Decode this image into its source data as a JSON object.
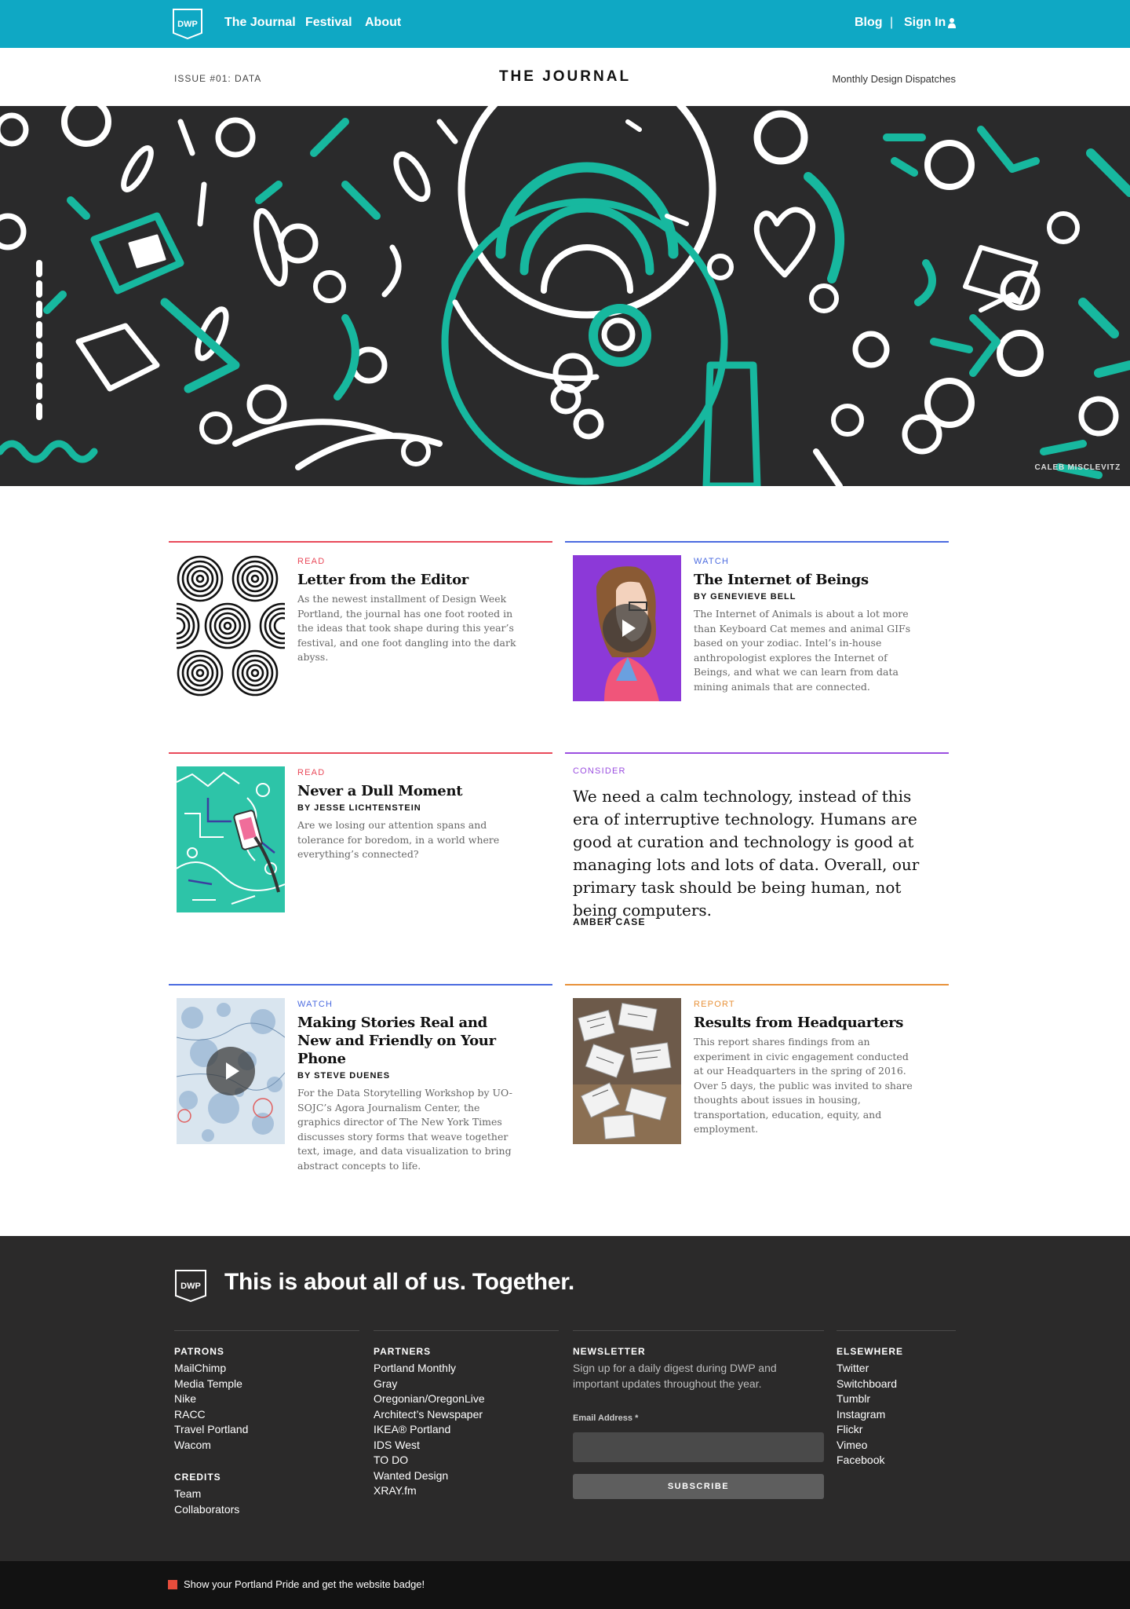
{
  "nav": {
    "logo_text": "DWP",
    "links": [
      "The Journal",
      "Festival",
      "About"
    ],
    "blog": "Blog",
    "separator": "|",
    "sign_in": "Sign In"
  },
  "masthead": {
    "issue": "ISSUE #01: DATA",
    "title": "THE JOURNAL",
    "tagline": "Monthly Design Dispatches"
  },
  "hero": {
    "credit": "CALEB MISCLEVITZ",
    "colors": {
      "background": "#2a2a2b",
      "teal": "#17b89f",
      "white": "#ffffff"
    }
  },
  "cards": [
    {
      "kind": "READ",
      "color": "#e94a5a",
      "title": "Letter from the Editor",
      "byline": "",
      "body": "As the newest installment of Design Week Portland, the journal has one foot rooted in the ideas that took shape during this year’s festival, and one foot dangling into the dark abyss.",
      "thumb": "spiral-pattern",
      "video": false
    },
    {
      "kind": "WATCH",
      "color": "#4b6be0",
      "title": "The Internet of Beings",
      "byline": "BY GENEVIEVE BELL",
      "body": "The Internet of Animals is about a lot more than Keyboard Cat memes and animal GIFs based on your zodiac. Intel’s in-house anthropologist explores the Internet of Beings, and what we can learn from data mining animals that are connected.",
      "thumb": "portrait-illustration",
      "video": true
    },
    {
      "kind": "READ",
      "color": "#e94a5a",
      "title": "Never a Dull Moment",
      "byline": "BY JESSE LICHTENSTEIN",
      "body": "Are we losing our attention spans and tolerance for boredom, in a world where everything’s connected?",
      "thumb": "teal-map-illustration",
      "video": false
    },
    {
      "kind": "WATCH",
      "color": "#4b6be0",
      "title": "Making Stories Real and New and Friendly on Your Phone",
      "byline": "BY STEVE DUENES",
      "body": "For the Data Storytelling Workshop by UO-SOJC’s Agora Journalism Center, the graphics director of The New York Times discusses story forms that weave together text, image, and data visualization to bring abstract concepts to life.",
      "thumb": "blue-dots-map",
      "video": true
    },
    {
      "kind": "REPORT",
      "color": "#e8923a",
      "title": "Results from Headquarters",
      "byline": "",
      "body": "This report shares findings from an experiment in civic engagement conducted at our Headquarters in the spring of 2016. Over 5 days, the public was invited to share thoughts about issues in housing, transportation, education, equity, and employment.",
      "thumb": "cards-photo",
      "video": false
    }
  ],
  "quote": {
    "kind": "CONSIDER",
    "color": "#9b4fe0",
    "text": "We need a calm technology, instead of this era of interruptive technology. Humans are good at curation and technology is good at managing lots and lots of data. Overall, our primary task should be being human, not being computers.",
    "author": "AMBER CASE"
  },
  "footer": {
    "logo_text": "DWP",
    "slogan": "This is about all of us. Together.",
    "patrons": {
      "heading": "PATRONS",
      "items": [
        "MailChimp",
        "Media Temple",
        "Nike",
        "RACC",
        "Travel Portland",
        "Wacom"
      ]
    },
    "credits": {
      "heading": "CREDITS",
      "items": [
        "Team",
        "Collaborators"
      ]
    },
    "partners": {
      "heading": "PARTNERS",
      "items": [
        "Portland Monthly",
        "Gray",
        "Oregonian/OregonLive",
        "Architect’s Newspaper",
        "IKEA® Portland",
        "IDS West",
        "TO DO",
        "Wanted Design",
        "XRAY.fm"
      ]
    },
    "newsletter": {
      "heading": "NEWSLETTER",
      "text": "Sign up for a daily digest during DWP and important updates throughout the year.",
      "email_label": "Email Address *",
      "email_value": "",
      "button": "SUBSCRIBE"
    },
    "elsewhere": {
      "heading": "ELSEWHERE",
      "items": [
        "Twitter",
        "Switchboard",
        "Tumblr",
        "Instagram",
        "Flickr",
        "Vimeo",
        "Facebook"
      ]
    }
  },
  "bottom_bar": {
    "text": "Show your Portland Pride and get the website badge!"
  }
}
